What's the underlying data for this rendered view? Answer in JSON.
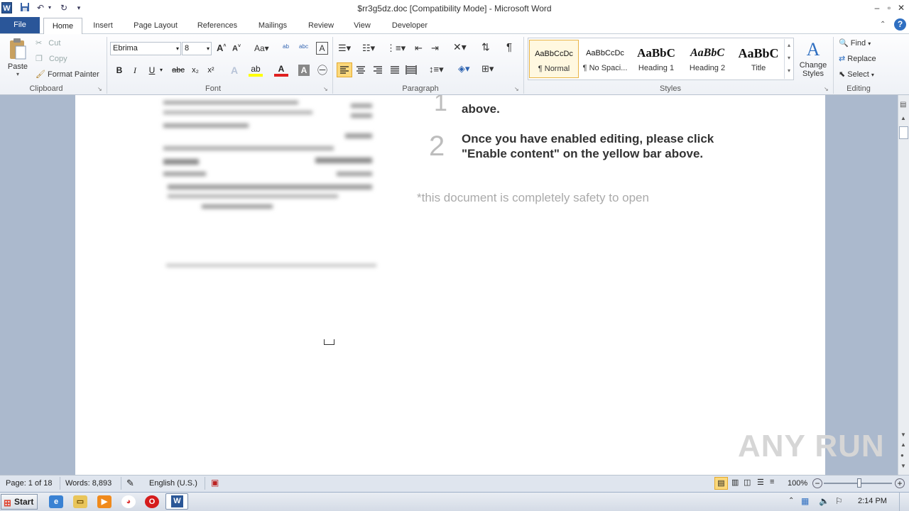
{
  "window": {
    "title": "$rr3g5dz.doc [Compatibility Mode]  -  Microsoft Word",
    "app_letter": "W",
    "minimize_icon": "minimize-icon",
    "restore_icon": "restore-icon",
    "close_icon": "close-icon"
  },
  "tabs": {
    "file": "File",
    "items": [
      "Home",
      "Insert",
      "Page Layout",
      "References",
      "Mailings",
      "Review",
      "View",
      "Developer"
    ]
  },
  "clipboard": {
    "paste": "Paste",
    "cut": "Cut",
    "copy": "Copy",
    "format_painter": "Format Painter",
    "group": "Clipboard"
  },
  "font": {
    "name": "Ebrima",
    "size": "8",
    "group": "Font",
    "bold": "B",
    "italic": "I",
    "underline": "U",
    "strike": "abc",
    "subscript": "x₂",
    "superscript": "x²"
  },
  "paragraph": {
    "group": "Paragraph",
    "pilcrow": "¶"
  },
  "styles": {
    "group": "Styles",
    "items": [
      {
        "preview": "AaBbCcDc",
        "name": "¶ Normal"
      },
      {
        "preview": "AaBbCcDc",
        "name": "¶ No Spaci..."
      },
      {
        "preview": "AaBbC",
        "name": "Heading 1"
      },
      {
        "preview": "AaBbC",
        "name": "Heading 2"
      },
      {
        "preview": "AaBbC",
        "name": "Title"
      }
    ],
    "change_styles_line1": "Change",
    "change_styles_line2": "Styles"
  },
  "editing": {
    "group": "Editing",
    "find": "Find",
    "replace": "Replace",
    "select": "Select"
  },
  "document": {
    "step1_num": "1",
    "step1_text": "above.",
    "step2_num": "2",
    "step2_line1": "Once you have enabled editing, please click",
    "step2_line2": "\"Enable content\" on the yellow bar above.",
    "note": "*this document is completely safety to open",
    "watermark": "ANY RUN"
  },
  "status": {
    "page": "Page: 1 of 18",
    "words": "Words: 8,893",
    "language": "English (U.S.)",
    "zoom": "100%"
  },
  "taskbar": {
    "start": "Start",
    "time": "2:14 PM"
  }
}
